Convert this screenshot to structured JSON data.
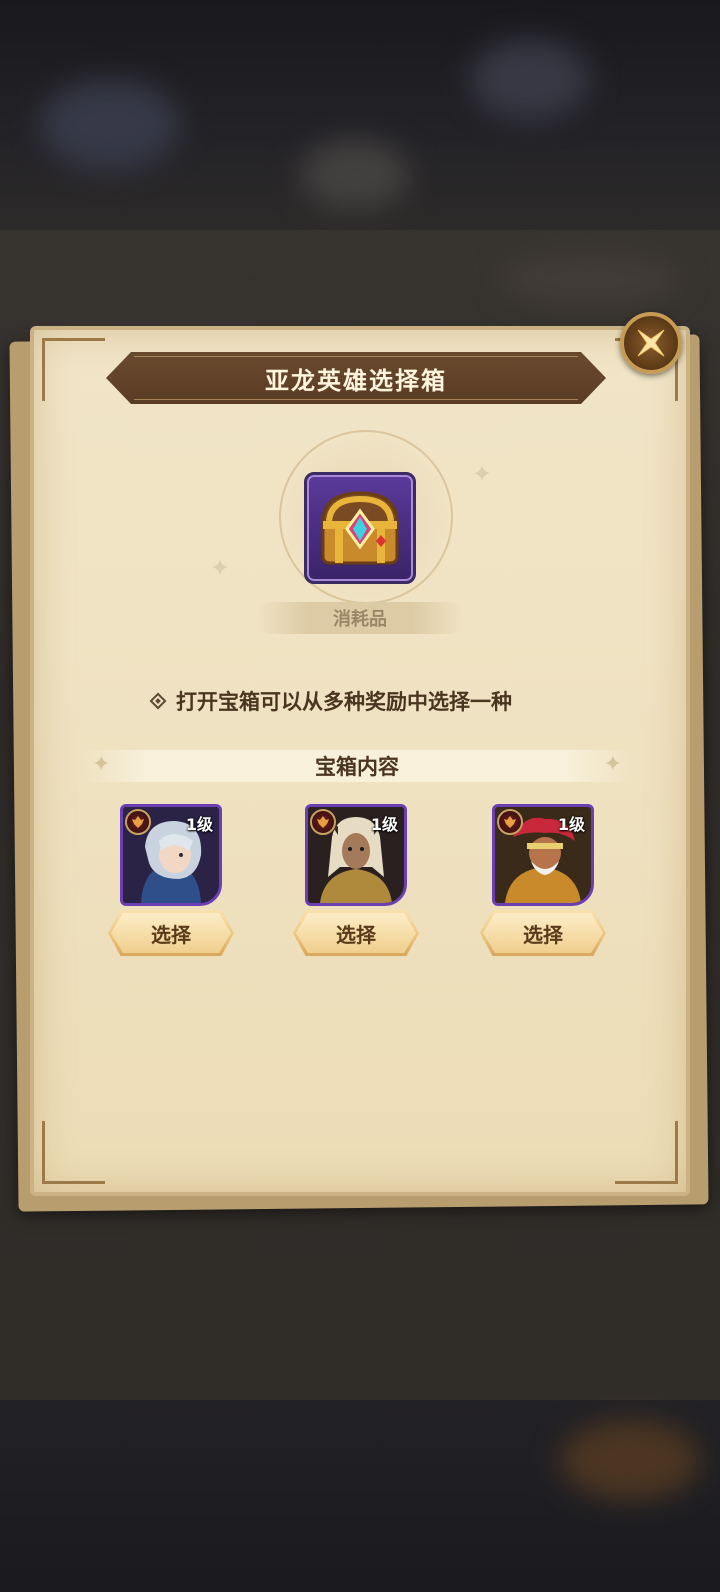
{
  "dialog": {
    "title": "亚龙英雄选择箱",
    "category": "消耗品",
    "description": "打开宝箱可以从多种奖励中选择一种",
    "section_title": "宝箱内容",
    "close_icon": "close-icon"
  },
  "item": {
    "icon": "treasure-chest-icon"
  },
  "heroes": [
    {
      "level": "1级",
      "button": "选择",
      "faction_icon": "dragon-faction-icon"
    },
    {
      "level": "1级",
      "button": "选择",
      "faction_icon": "dragon-faction-icon"
    },
    {
      "level": "1级",
      "button": "选择",
      "faction_icon": "dragon-faction-icon"
    }
  ],
  "colors": {
    "parchment": "#efe2c1",
    "banner": "#5a3c24",
    "epic_frame": "#6b3fb3",
    "button_gold": "#ecc27b"
  }
}
